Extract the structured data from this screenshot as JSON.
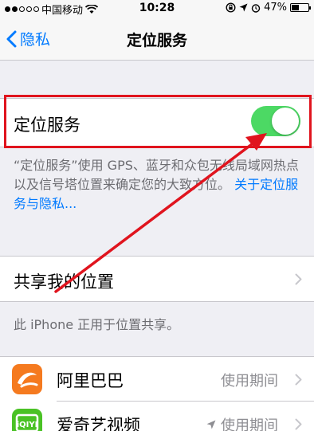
{
  "status_bar": {
    "carrier": "中国移动",
    "time": "10:28",
    "battery": "47%",
    "battery_level": 0.47
  },
  "nav": {
    "back_label": "隐私",
    "title": "定位服务"
  },
  "location_services": {
    "label": "定位服务",
    "enabled": true,
    "description": "“定位服务”使用 GPS、蓝牙和众包无线局域网热点以及信号塔位置来确定您的大致方位。",
    "link": "关于定位服务与隐私..."
  },
  "share": {
    "label": "共享我的位置",
    "footer": "此 iPhone 正用于位置共享。"
  },
  "apps": [
    {
      "name": "阿里巴巴",
      "value": "使用期间",
      "icon": "alibaba-app-icon",
      "color": "#f57a1f"
    },
    {
      "name": "爱奇艺视频",
      "value": "使用期间",
      "icon": "iqiyi-app-icon",
      "color": "#4ac225"
    }
  ],
  "colors": {
    "accent": "#007aff",
    "toggle_on": "#4cd964",
    "annotation": "#e0141e"
  }
}
